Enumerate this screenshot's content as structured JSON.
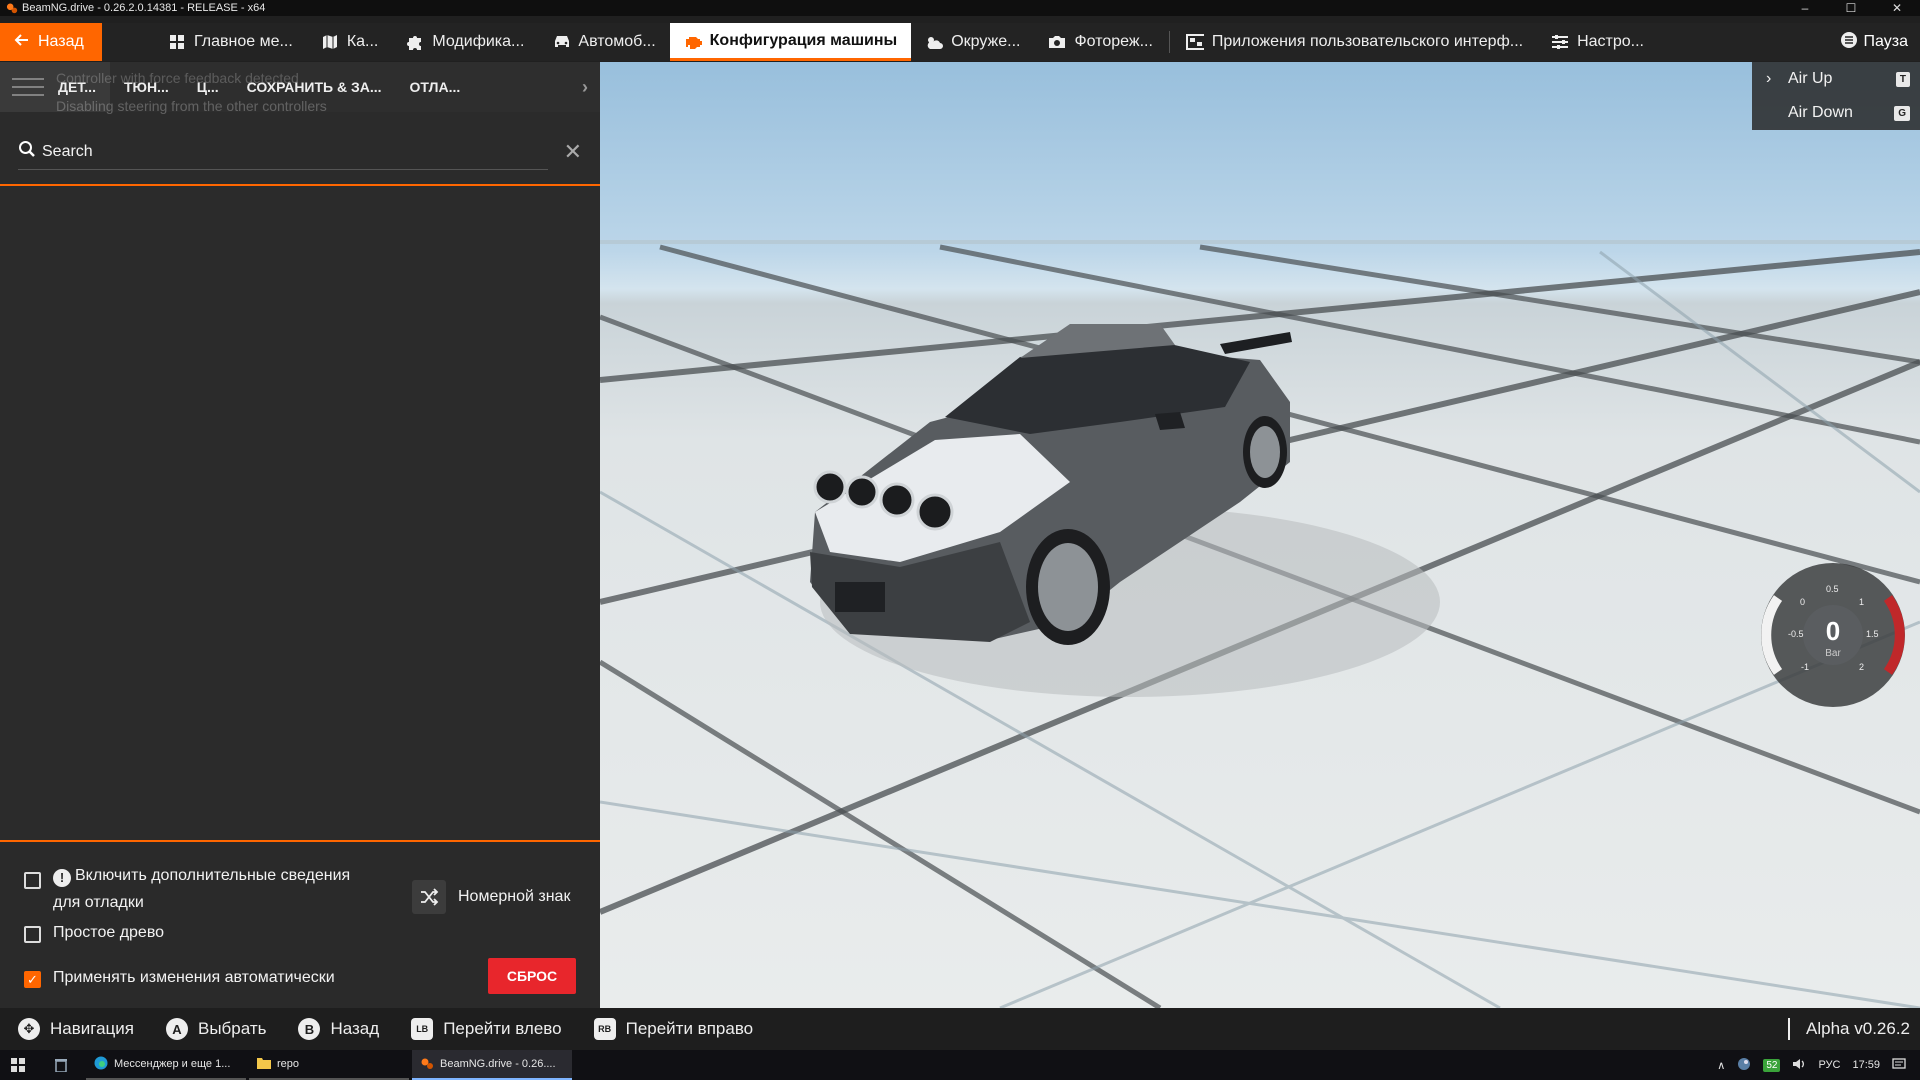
{
  "window": {
    "title": "BeamNG.drive - 0.26.2.0.14381 - RELEASE - x64",
    "controls": [
      "–",
      "☐",
      "✕"
    ]
  },
  "topnav": {
    "back_label": "Назад",
    "tabs": [
      {
        "label": "Главное ме...",
        "icon": "grid-icon"
      },
      {
        "label": "Ка...",
        "icon": "map-icon"
      },
      {
        "label": "Модифика...",
        "icon": "puzzle-icon"
      },
      {
        "label": "Автомоб...",
        "icon": "car-icon"
      },
      {
        "label": "Конфигурация машины",
        "icon": "engine-icon",
        "active": true
      },
      {
        "label": "Окруже...",
        "icon": "weather-icon"
      },
      {
        "label": "Фотореж...",
        "icon": "camera-icon"
      },
      {
        "label": "Приложения пользовательского интерф...",
        "icon": "apps-icon"
      },
      {
        "label": "Настро...",
        "icon": "sliders-icon"
      }
    ],
    "pause_label": "Пауза"
  },
  "left_panel": {
    "subtabs": [
      "ДЕТ...",
      "ТЮН...",
      "Ц...",
      "СОХРАНИТЬ & ЗА...",
      "ОТЛА..."
    ],
    "ghost_message_1": "Controller with force feedback detected",
    "ghost_message_2": "Disabling steering from the other controllers",
    "search_placeholder": "Search",
    "options": {
      "debug_label_1": "Включить дополнительные сведения",
      "debug_label_2": "для отладки",
      "simple_tree_label": "Простое древо",
      "auto_apply_label": "Применять изменения автоматически",
      "license_plate_label": "Номерной знак",
      "reset_label": "СБРОС"
    }
  },
  "air_widget": {
    "up_label": "Air Up",
    "up_key": "T",
    "down_label": "Air Down",
    "down_key": "G"
  },
  "gauge": {
    "value": "0",
    "unit": "Bar",
    "ticks": [
      "-1",
      "-0.5",
      "0",
      "0.5",
      "1",
      "1.5",
      "2"
    ]
  },
  "hintbar": {
    "hints": [
      {
        "button": "✥",
        "label": "Навигация"
      },
      {
        "button": "A",
        "label": "Выбрать"
      },
      {
        "button": "B",
        "label": "Назад"
      },
      {
        "button": "LB",
        "label": "Перейти влево"
      },
      {
        "button": "RB",
        "label": "Перейти вправо"
      }
    ],
    "version": "Alpha v0.26.2"
  },
  "taskbar": {
    "items": [
      {
        "label": "Мессенджер и еще 1...",
        "active": false
      },
      {
        "label": "repo",
        "active": false
      },
      {
        "label": "BeamNG.drive - 0.26....",
        "active": true
      }
    ],
    "badge": "52",
    "language": "РУС",
    "time": "17:59"
  },
  "colors": {
    "accent": "#ff6600",
    "reset": "#e8262c",
    "panel": "#2b2b2b"
  }
}
